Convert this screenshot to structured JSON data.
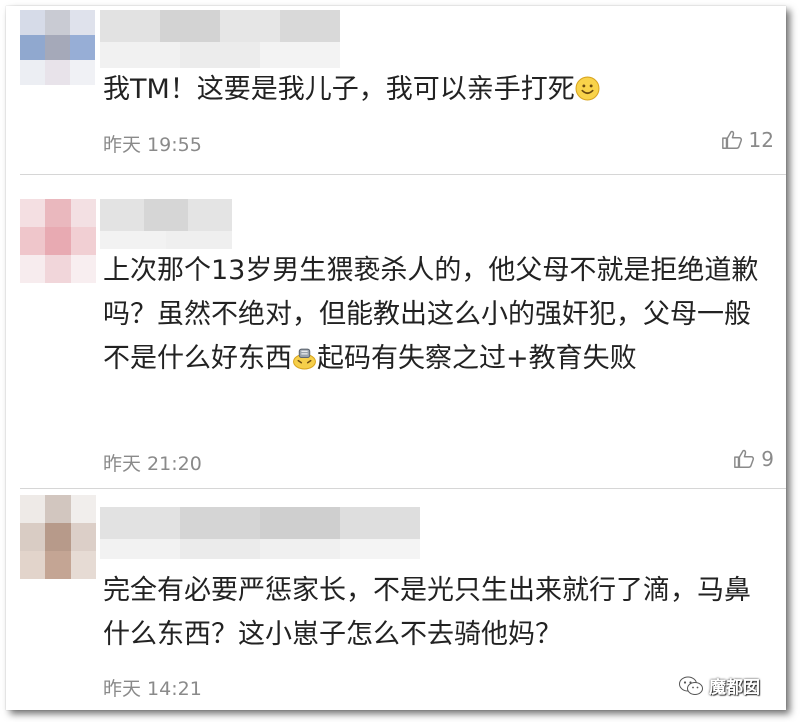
{
  "comments": [
    {
      "text": "我TM！这要是我儿子，我可以亲手打死",
      "emoji": "smile-emoji",
      "time": "昨天 19:55",
      "likes": "12"
    },
    {
      "text_parts": [
        "上次那个13岁男生猥亵杀人的，他父母不就是拒绝道歉吗？虽然不绝对，但能教出这么小的强奸犯，父母一般不是什么好东西",
        "起码有失察之过+教育失败"
      ],
      "emoji": "facepalm-emoji",
      "time": "昨天 21:20",
      "likes": "9"
    },
    {
      "text": "完全有必要严惩家长，不是光只生出来就行了滴，马鼻什么东西？这小崽子怎么不去骑他妈？",
      "time": "昨天 14:21",
      "likes": ""
    }
  ],
  "watermark": {
    "icon": "wechat-icon",
    "label": "魔都囡"
  },
  "colors": {
    "text": "#222222",
    "meta": "#8a8a8a",
    "divider": "#d6d6d6"
  }
}
